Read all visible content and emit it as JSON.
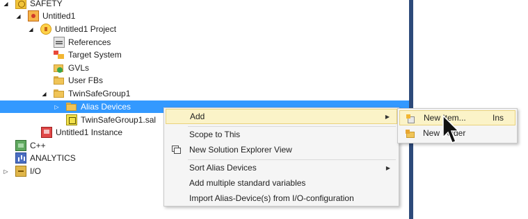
{
  "tree": [
    {
      "label": "SAFETY",
      "expander": "open",
      "icon": "safety-project-icon"
    },
    {
      "label": "Untitled1",
      "expander": "open",
      "icon": "safety-app-icon"
    },
    {
      "label": "Untitled1 Project",
      "expander": "open",
      "icon": "twinsafe-project-icon"
    },
    {
      "label": "References",
      "expander": "none",
      "icon": "references-icon"
    },
    {
      "label": "Target System",
      "expander": "none",
      "icon": "target-system-icon"
    },
    {
      "label": "GVLs",
      "expander": "none",
      "icon": "gvl-folder-icon"
    },
    {
      "label": "User FBs",
      "expander": "none",
      "icon": "folder-icon"
    },
    {
      "label": "TwinSafeGroup1",
      "expander": "open",
      "icon": "folder-icon"
    },
    {
      "label": "Alias Devices",
      "expander": "closed",
      "icon": "folder-icon",
      "selected": true
    },
    {
      "label": "TwinSafeGroup1.sal",
      "expander": "none",
      "icon": "sal-file-icon"
    },
    {
      "label": "Untitled1 Instance",
      "expander": "none",
      "icon": "instance-icon"
    },
    {
      "label": "C++",
      "expander": "none",
      "icon": "cpp-icon"
    },
    {
      "label": "ANALYTICS",
      "expander": "none",
      "icon": "analytics-icon"
    },
    {
      "label": "I/O",
      "expander": "closed",
      "icon": "io-icon"
    }
  ],
  "context_menu": {
    "add": "Add",
    "scope_to_this": "Scope to This",
    "new_solution_explorer_view": "New Solution Explorer View",
    "sort_alias_devices": "Sort Alias Devices",
    "add_multiple_standard_variables": "Add multiple standard variables",
    "import_alias_devices": "Import Alias-Device(s) from I/O-configuration"
  },
  "submenu": {
    "new_item": "New Item...",
    "new_item_shortcut": "Ins",
    "new_folder": "New Folder"
  },
  "colors": {
    "selection": "#3399ff",
    "menu_highlight": "#fbf3c8",
    "pane_divider": "#2d4a7a"
  }
}
